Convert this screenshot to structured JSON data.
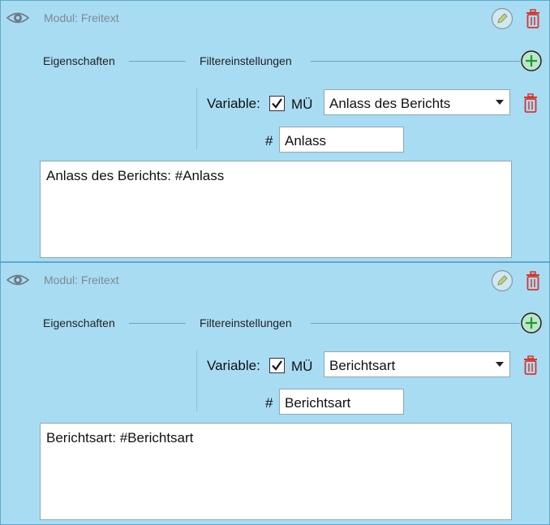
{
  "colors": {
    "background": "#a8dcf2",
    "trash": "#d9352f",
    "plus": "#1a9a38",
    "pencil": "#9aaa55"
  },
  "modules": [
    {
      "title": "Modul: Freitext",
      "tab_properties": "Eigenschaften",
      "tab_filter": "Filtereinstellungen",
      "variable_label": "Variable:",
      "checkbox_label": "MÜ",
      "checkbox_checked": true,
      "select_value": "Anlass des Berichts",
      "hash_label": "#",
      "variable_name": "Anlass",
      "text": "Anlass des Berichts: #Anlass",
      "icons": [
        "eye-icon",
        "pencil-icon",
        "trash-icon",
        "plus-icon",
        "check-icon",
        "chevron-down-icon"
      ]
    },
    {
      "title": "Modul: Freitext",
      "tab_properties": "Eigenschaften",
      "tab_filter": "Filtereinstellungen",
      "variable_label": "Variable:",
      "checkbox_label": "MÜ",
      "checkbox_checked": true,
      "select_value": "Berichtsart",
      "hash_label": "#",
      "variable_name": "Berichtsart",
      "text": "Berichtsart: #Berichtsart",
      "icons": [
        "eye-icon",
        "pencil-icon",
        "trash-icon",
        "plus-icon",
        "check-icon",
        "chevron-down-icon"
      ]
    }
  ]
}
